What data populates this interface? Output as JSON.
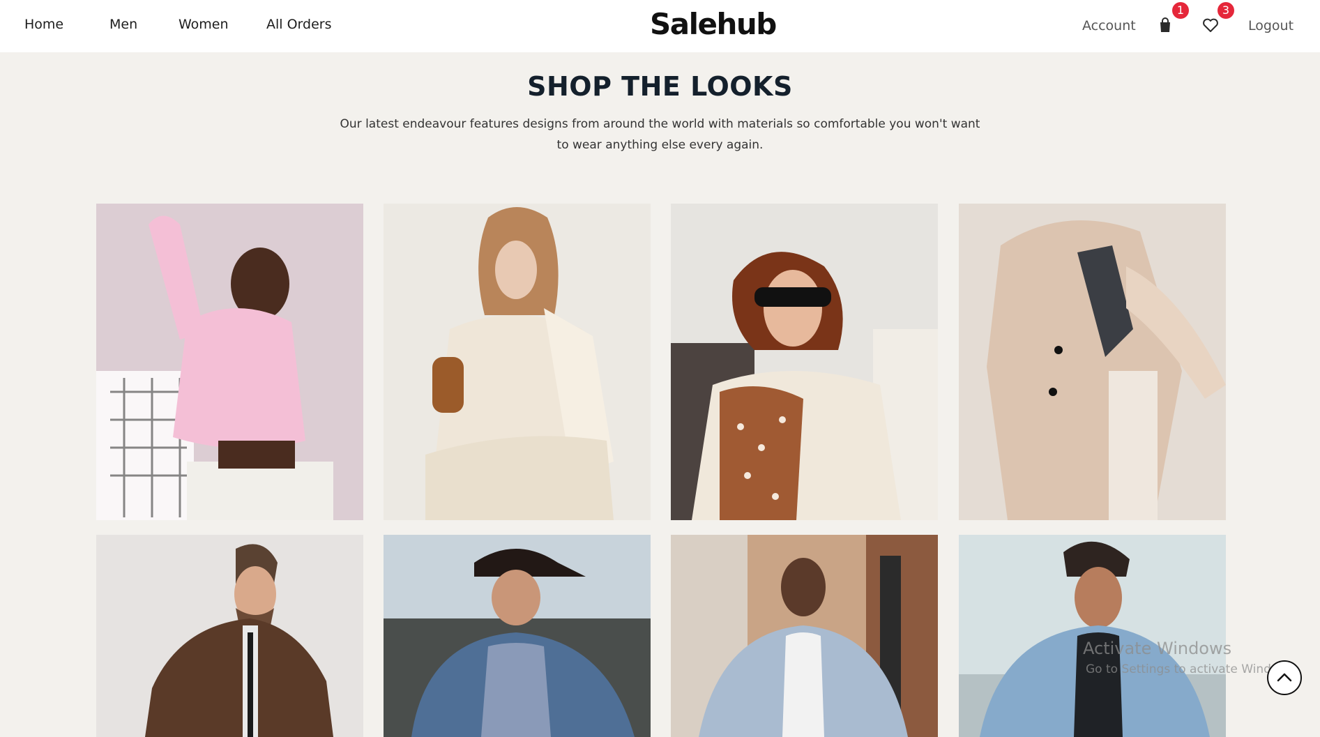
{
  "nav": {
    "links": [
      "Home",
      "Men",
      "Women",
      "All Orders"
    ],
    "brand": "Salehub",
    "account": "Account",
    "cart_count": "1",
    "wishlist_count": "3",
    "logout": "Logout"
  },
  "section": {
    "title": "SHOP THE LOOKS",
    "description": "Our latest endeavour features designs from around the world with materials so comfortable you won't want to wear anything else every again."
  },
  "looks": [
    {
      "label": "woman in pink top with grid tote bag",
      "bg": "#dccdd3",
      "accent": "#f4bfd6"
    },
    {
      "label": "woman in cream knit set",
      "bg": "#ece9e3",
      "accent": "#efe6d8"
    },
    {
      "label": "woman in sunglasses with polka dot scarf",
      "bg": "#e6e4e0",
      "accent": "#a05a33"
    },
    {
      "label": "woman in beige blazer",
      "bg": "#e4dcd4",
      "accent": "#dcc4b0"
    },
    {
      "label": "man in brown trench coat",
      "bg": "#e6e3e1",
      "accent": "#5a3a28"
    },
    {
      "label": "man in cap and denim jacket",
      "bg": "#7f8a94",
      "accent": "#4f6f96"
    },
    {
      "label": "man in glasses with denim jacket",
      "bg": "#c9a486",
      "accent": "#a9bbd0"
    },
    {
      "label": "man in light denim jacket",
      "bg": "#d6e1e3",
      "accent": "#86aacb"
    }
  ],
  "watermark": {
    "title": "Activate Windows",
    "subtitle": "Go to Settings to activate Windows."
  },
  "icons": {
    "cart": "shopping-bag-icon",
    "wishlist": "heart-icon",
    "scroll": "chevron-up-icon"
  }
}
